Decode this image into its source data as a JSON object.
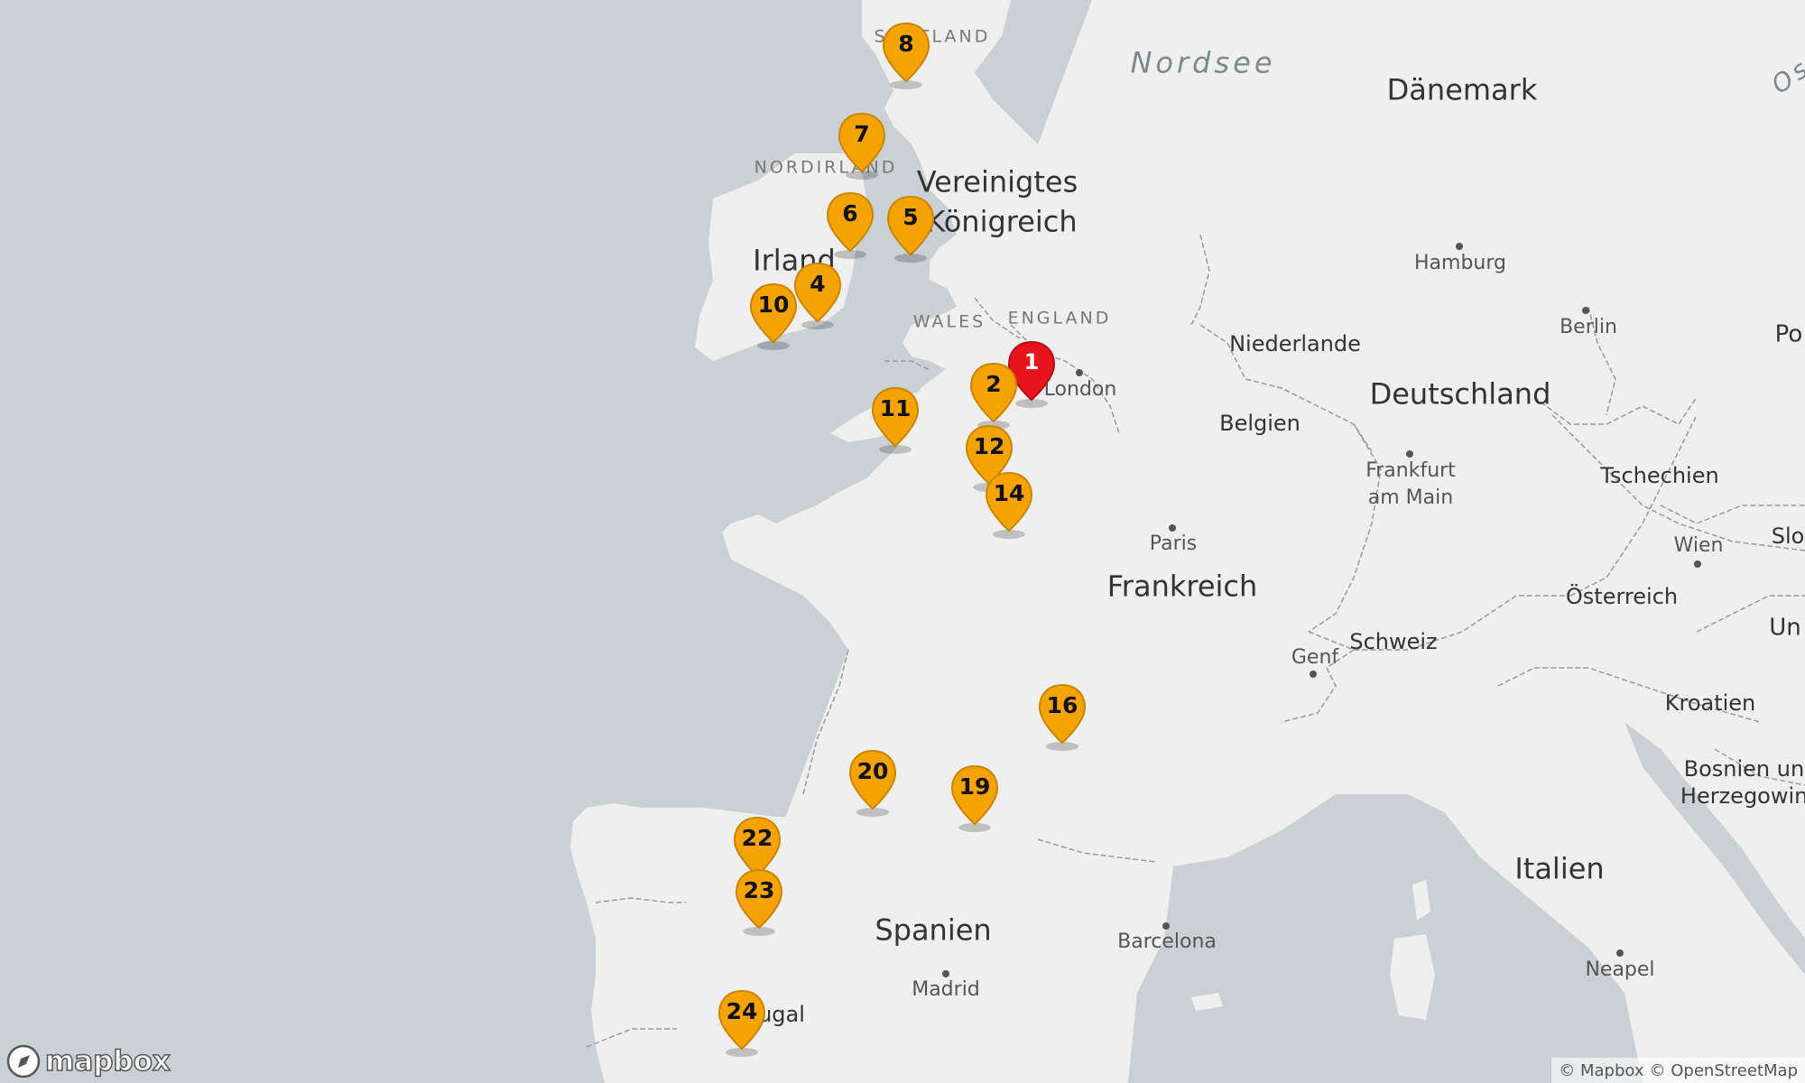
{
  "colors": {
    "water": "#c9d1d4",
    "land": "#efefef",
    "border": "#999999",
    "marker": "#f5a300",
    "marker_active": "#e8141c"
  },
  "labels": {
    "sea": {
      "nordsee": "Nordsee",
      "ostsee": "Os"
    },
    "countries": {
      "daenemark": "Dänemark",
      "vereinigtes": "Vereinigtes",
      "koenigreich": "Königreich",
      "irland": "Irland",
      "deutschland": "Deutschland",
      "niederlande": "Niederlande",
      "belgien": "Belgien",
      "frankreich": "Frankreich",
      "schweiz": "Schweiz",
      "tschechien": "Tschechien",
      "oesterreich": "Österreich",
      "kroatien": "Kroatien",
      "bosnien_1": "Bosnien und",
      "bosnien_2": "Herzegowina",
      "italien": "Italien",
      "spanien": "Spanien",
      "portugal": "ugal",
      "polen": "Po",
      "slowakei": "Slo",
      "ungarn": "Un"
    },
    "regions": {
      "scotland": "SCOTLAND",
      "nordirland": "NORDIRLAND",
      "wales": "WALES",
      "england": "ENGLAND"
    },
    "cities": {
      "london": "London",
      "hamburg": "Hamburg",
      "berlin": "Berlin",
      "paris": "Paris",
      "frankfurt_1": "Frankfurt",
      "frankfurt_2": "am Main",
      "wien": "Wien",
      "genf": "Genf",
      "barcelona": "Barcelona",
      "madrid": "Madrid",
      "neapel": "Neapel"
    }
  },
  "markers": [
    {
      "label": "1",
      "type": "active"
    },
    {
      "label": "2",
      "type": "default"
    },
    {
      "label": "4",
      "type": "default"
    },
    {
      "label": "5",
      "type": "default"
    },
    {
      "label": "6",
      "type": "default"
    },
    {
      "label": "7",
      "type": "default"
    },
    {
      "label": "8",
      "type": "default"
    },
    {
      "label": "10",
      "type": "default"
    },
    {
      "label": "11",
      "type": "default"
    },
    {
      "label": "12",
      "type": "default"
    },
    {
      "label": "14",
      "type": "default"
    },
    {
      "label": "16",
      "type": "default"
    },
    {
      "label": "19",
      "type": "default"
    },
    {
      "label": "20",
      "type": "default"
    },
    {
      "label": "22",
      "type": "default"
    },
    {
      "label": "23",
      "type": "default"
    },
    {
      "label": "24",
      "type": "default"
    }
  ],
  "logo": {
    "text": "mapbox"
  },
  "attribution": {
    "mapbox": "© Mapbox",
    "osm": "© OpenStreetMap"
  }
}
